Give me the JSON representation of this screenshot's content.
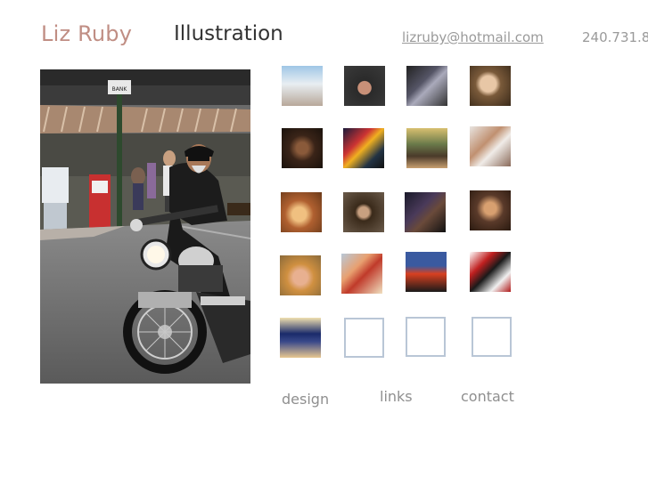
{
  "header": {
    "name": "Liz Ruby",
    "section": "Illustration",
    "email": "lizruby@hotmail.com",
    "phone": "240.731.8"
  },
  "colors": {
    "name": "#c08e84",
    "thumb_border": "#b9c6d6",
    "nav_text": "#8f8f8f",
    "contact_text": "#9a9a9a"
  },
  "hero": {
    "alt": "motorcycle-rider-painting",
    "sign_text": "BANK"
  },
  "thumbnails": [
    {
      "id": "thumb-lighthouse",
      "style": "linear-gradient(180deg,#9fc6e6 0%,#e8eef2 45%,#b8a89a 100%)"
    },
    {
      "id": "thumb-biker-closeup",
      "style": "radial-gradient(circle at 50% 55%,#c89078 0 22%,#2a2a2a 24%,#3a3a3a 100%)"
    },
    {
      "id": "thumb-bikers-group",
      "style": "linear-gradient(135deg,#222 0%,#556 40%,#aab 55%,#333 100%)"
    },
    {
      "id": "thumb-old-man",
      "style": "radial-gradient(circle at 45% 45%,#e8c7a6 0 25%,#7a5a3a 40%,#3a2a1a 100%)"
    },
    {
      "id": "thumb-dark-swirl",
      "style": "radial-gradient(circle at 50% 50%,#8a5a3a 0 20%,#3a2418 45%,#1a120c 100%)"
    },
    {
      "id": "thumb-crowd-night",
      "style": "linear-gradient(135deg,#1a1a3a 0%,#c33 35%,#f0b020 50%,#234 75%,#111 100%)"
    },
    {
      "id": "thumb-street-lights",
      "style": "linear-gradient(180deg,#d8c070 0%,#6a7a4a 40%,#4a3a2a 70%,#c8a070 100%)"
    },
    {
      "id": "thumb-figures",
      "style": "linear-gradient(135deg,#e8e4e0 0%,#c09070 40%,#f0ece8 60%,#8a6a5a 100%)"
    },
    {
      "id": "thumb-faces-warm",
      "style": "radial-gradient(circle at 45% 55%,#f0c080 0 22%,#b06030 45%,#6a3a1a 100%)"
    },
    {
      "id": "thumb-girl-portrait",
      "style": "radial-gradient(circle at 50% 50%,#c8a080 0 18%,#3a2a1a 30%,#6a5a4a 100%)"
    },
    {
      "id": "thumb-dark-abstract",
      "style": "linear-gradient(135deg,#1a1a2a 0%,#4a3a5a 40%,#6a4a3a 60%,#111 100%)"
    },
    {
      "id": "thumb-couple",
      "style": "radial-gradient(circle at 50% 45%,#d8a070 0 20%,#5a3a2a 45%,#2a1a10 100%)"
    },
    {
      "id": "thumb-woman-drinking",
      "style": "radial-gradient(circle at 50% 55%,#e8b090 0 24%,#d09040 45%,#8a6a3a 100%)"
    },
    {
      "id": "thumb-cats",
      "style": "linear-gradient(135deg,#b8c8d8 0%,#e8a070 35%,#c03a2a 55%,#f0e0c0 100%)"
    },
    {
      "id": "thumb-poster",
      "style": "linear-gradient(180deg,#3a5aa0 0%,#3a5aa0 35%,#d84020 55%,#1a1a1a 100%)"
    },
    {
      "id": "thumb-bowling",
      "style": "linear-gradient(135deg,#fff 0%,#c02020 30%,#1a1a1a 50%,#f0f0f0 75%,#b01a1a 100%)"
    },
    {
      "id": "thumb-eiffel",
      "style": "linear-gradient(180deg,#f0e0b0 0%,#1a2a6a 40%,#3a4a8a 60%,#e8c890 100%)"
    },
    {
      "id": "thumb-empty-1",
      "style": "empty"
    },
    {
      "id": "thumb-empty-2",
      "style": "empty"
    },
    {
      "id": "thumb-empty-3",
      "style": "empty"
    }
  ],
  "nav": {
    "design": "design",
    "links": "links",
    "contact": "contact"
  }
}
